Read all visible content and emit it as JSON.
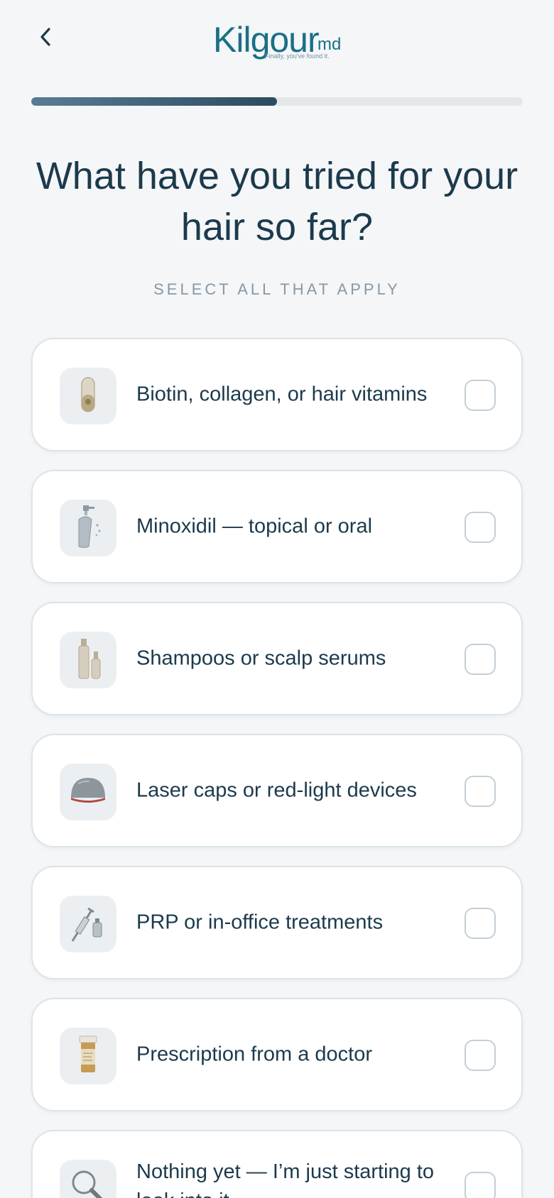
{
  "header": {
    "back_icon": "chevron-left-icon",
    "logo_name": "Kilgour",
    "logo_suffix": "md",
    "logo_tagline": "Finally, you've found it."
  },
  "progress": {
    "fraction": 0.5
  },
  "question": {
    "title": "What have you tried for your hair so far?",
    "instruction": "SELECT ALL THAT APPLY"
  },
  "options": [
    {
      "label": "Biotin, collagen, or hair vitamins",
      "icon": "supplement-capsule-icon",
      "checked": false
    },
    {
      "label": "Minoxidil — topical or oral",
      "icon": "spray-bottle-icon",
      "checked": false
    },
    {
      "label": "Shampoos or scalp serums",
      "icon": "serum-bottles-icon",
      "checked": false
    },
    {
      "label": "Laser caps or red-light devices",
      "icon": "laser-cap-icon",
      "checked": false
    },
    {
      "label": "PRP or in-office treatments",
      "icon": "syringe-vial-icon",
      "checked": false
    },
    {
      "label": "Prescription from a doctor",
      "icon": "pill-bottle-icon",
      "checked": false
    },
    {
      "label": "Nothing yet — I’m just starting to look into it",
      "icon": "magnifier-icon",
      "checked": false
    }
  ],
  "colors": {
    "brand": "#1b6f86",
    "text": "#1c3a4c",
    "muted": "#8799a6",
    "progress_fill": "#2c4b5f",
    "background": "#f4f6f8"
  }
}
